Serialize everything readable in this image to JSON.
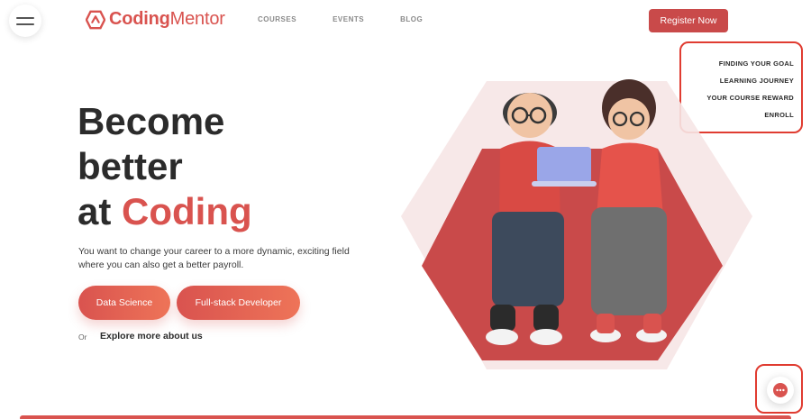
{
  "brand": {
    "name_part1": "Coding",
    "name_part2": "Mentor",
    "accent": "#d9534f"
  },
  "nav": {
    "items": [
      "COURSES",
      "EVENTS",
      "BLOG"
    ]
  },
  "header": {
    "register_label": "Register Now"
  },
  "toc": {
    "items": [
      "FINDING YOUR GOAL",
      "LEARNING JOURNEY",
      "YOUR COURSE REWARD",
      "ENROLL"
    ]
  },
  "hero": {
    "line1": "Become",
    "line2": "better",
    "line3_prefix": "at",
    "line3_accent": "Coding",
    "description": "You want to change your career to a more dynamic, exciting field where you can also get a better payroll."
  },
  "cta": {
    "primary": "Data Science",
    "secondary": "Full-stack Developer"
  },
  "explore": {
    "or": "Or",
    "link": "Explore more about us"
  },
  "icons": {
    "menu": "hamburger-icon",
    "logo": "logo-mark-icon",
    "chat": "chat-icon"
  }
}
